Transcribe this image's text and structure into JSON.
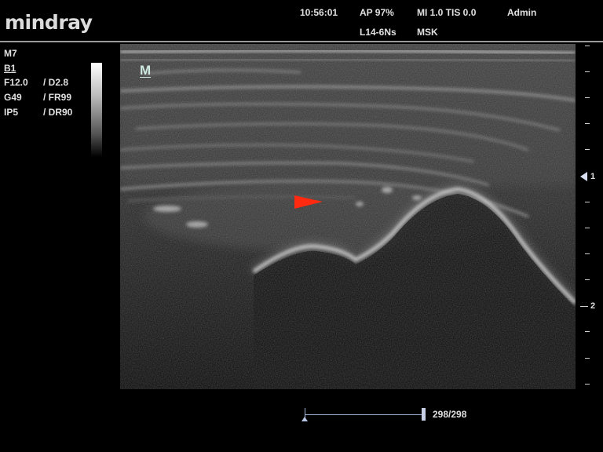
{
  "header": {
    "brand": "mindray",
    "time": "10:56:01",
    "ap": "AP  97%",
    "mi_tis": "MI 1.0  TIS 0.0",
    "user": "Admin",
    "probe": "L14-6Ns",
    "preset": "MSK"
  },
  "params": {
    "mode": "M7",
    "image_label": "B1",
    "rows": [
      {
        "a": "F12.0",
        "b": "/ D2.8"
      },
      {
        "a": "G49",
        "b": "/ FR99"
      },
      {
        "a": "IP5",
        "b": "/ DR90"
      }
    ]
  },
  "image": {
    "orientation_marker": "M",
    "arrowhead_color": "#ff2a10"
  },
  "depth_scale": {
    "focus_marker": "1",
    "label_2": "2"
  },
  "cine": {
    "frame_count": "298/298",
    "progress": 1.0
  }
}
